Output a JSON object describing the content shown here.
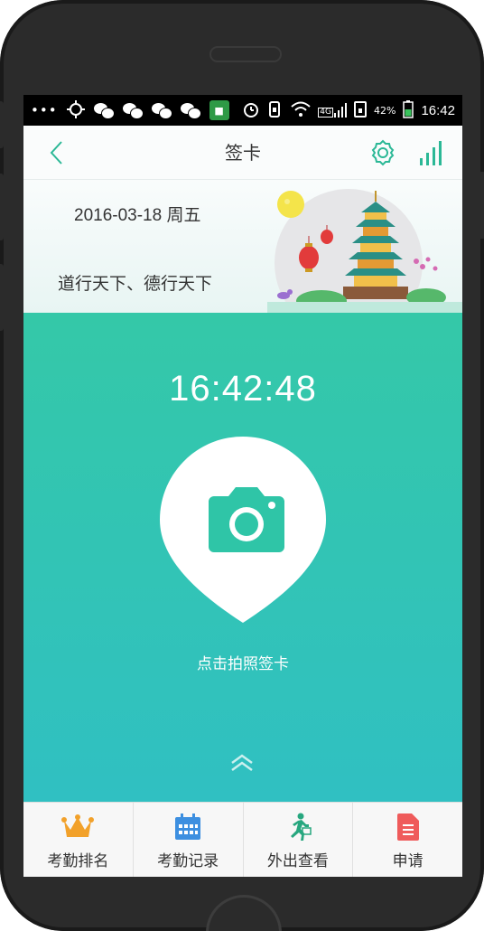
{
  "status_bar": {
    "battery_percent": "42%",
    "time": "16:42",
    "network": "4G"
  },
  "nav": {
    "title": "签卡",
    "accent": "#2bb896"
  },
  "banner": {
    "date": "2016-03-18 周五",
    "motto": "道行天下、德行天下"
  },
  "main": {
    "clock": "16:42:48",
    "photo_hint": "点击拍照签卡",
    "bg_top": "#34c8a8",
    "bg_bottom": "#30c0c2"
  },
  "tabs": [
    {
      "label": "考勤排名",
      "icon": "crown-icon",
      "color": "#f2a12a"
    },
    {
      "label": "考勤记录",
      "icon": "calendar-icon",
      "color": "#3d8fe0"
    },
    {
      "label": "外出查看",
      "icon": "runner-icon",
      "color": "#27a77f"
    },
    {
      "label": "申请",
      "icon": "document-icon",
      "color": "#ef5b5b"
    }
  ]
}
